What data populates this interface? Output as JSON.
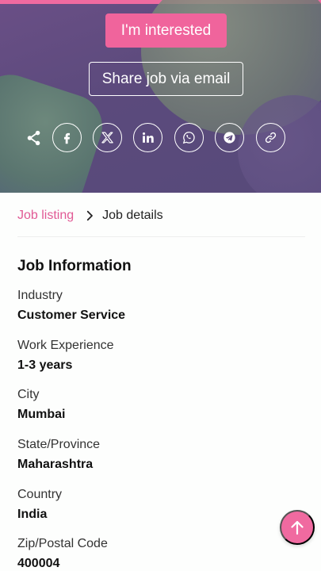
{
  "hero": {
    "interested_label": "I'm interested",
    "share_email_label": "Share job via email",
    "social": [
      "share-icon",
      "facebook-icon",
      "x-icon",
      "linkedin-icon",
      "whatsapp-icon",
      "telegram-icon",
      "link-icon"
    ]
  },
  "breadcrumb": {
    "link": "Job listing",
    "current": "Job details"
  },
  "job_info": {
    "title": "Job Information",
    "fields": [
      {
        "label": "Industry",
        "value": "Customer Service"
      },
      {
        "label": "Work Experience",
        "value": "1-3 years"
      },
      {
        "label": "City",
        "value": "Mumbai"
      },
      {
        "label": "State/Province",
        "value": "Maharashtra"
      },
      {
        "label": "Country",
        "value": "India"
      },
      {
        "label": "Zip/Postal Code",
        "value": "400004"
      }
    ]
  },
  "colors": {
    "accent": "#f0649c",
    "link": "#e15a95",
    "hero_bg": "#5b4a7c"
  },
  "fab": {
    "icon": "arrow-up-icon"
  }
}
